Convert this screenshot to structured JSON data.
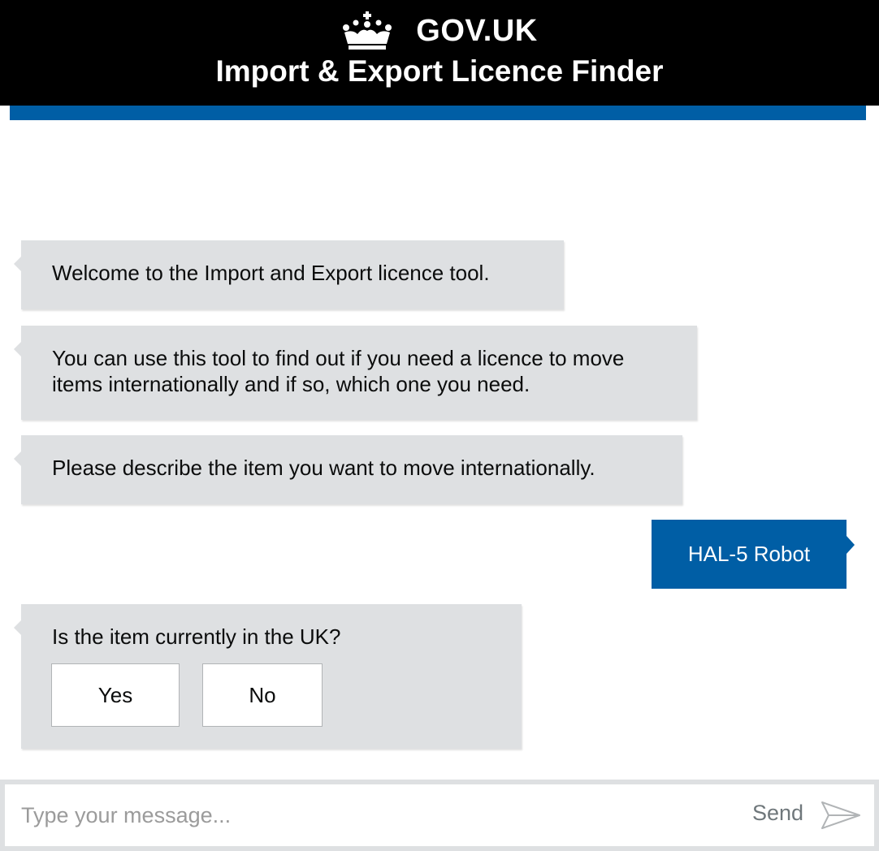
{
  "header": {
    "logo_icon": "crown-icon",
    "brand": "GOV.UK",
    "service_name": "Import & Export Licence Finder",
    "accent_color": "#005ea5"
  },
  "conversation": {
    "bot_messages": [
      "Welcome to the Import and Export licence tool.",
      "You can use this tool to find out if you need a licence to move items internationally and if so, which one you need.",
      "Please describe the item you want to move internationally."
    ],
    "user_message": "HAL-5 Robot",
    "question": {
      "text": "Is the item currently in the UK?",
      "options": [
        "Yes",
        "No"
      ]
    }
  },
  "composer": {
    "placeholder": "Type your message...",
    "value": "",
    "send_label": "Send",
    "send_icon": "paper-plane-icon"
  }
}
